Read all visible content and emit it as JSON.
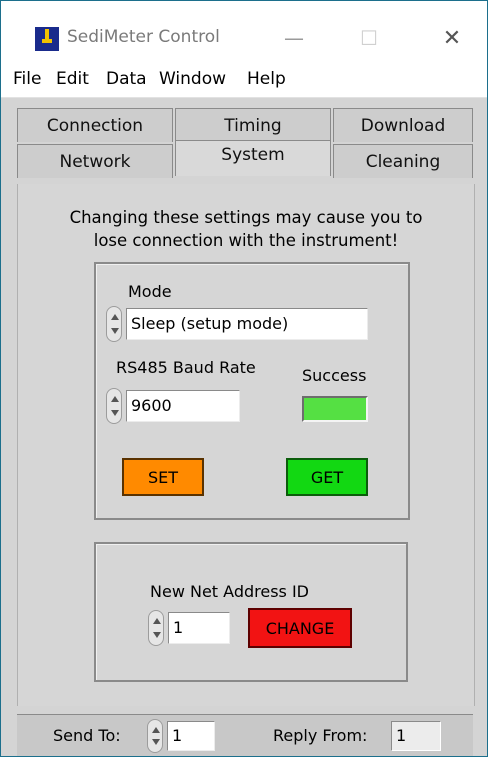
{
  "window": {
    "title": "SediMeter Control",
    "minimize_glyph": "—",
    "maximize_glyph": "☐",
    "close_glyph": "✕"
  },
  "menu": [
    "File",
    "Edit",
    "Data",
    "Window",
    "Help"
  ],
  "tabs": {
    "row1": [
      "Connection",
      "Timing",
      "Download"
    ],
    "row2": [
      "Network",
      "System",
      "Cleaning"
    ],
    "active": "System"
  },
  "system": {
    "warning_line1": "Changing these settings may cause you to",
    "warning_line2": "lose connection with the instrument!",
    "mode_label": "Mode",
    "mode_value": "Sleep (setup mode)",
    "baud_label": "RS485 Baud Rate",
    "baud_value": "9600",
    "success_label": "Success",
    "success_state": "on",
    "set_label": "SET",
    "get_label": "GET",
    "net_address_label": "New Net Address ID",
    "net_address_value": "1",
    "change_label": "CHANGE"
  },
  "status": {
    "send_to_label": "Send To:",
    "send_to_value": "1",
    "reply_from_label": "Reply From:",
    "reply_from_value": "1"
  },
  "colors": {
    "set": "#ff8a00",
    "get": "#12d812",
    "change": "#f21313",
    "success_led": "#55e043",
    "app_icon": "#1a2b8c"
  }
}
